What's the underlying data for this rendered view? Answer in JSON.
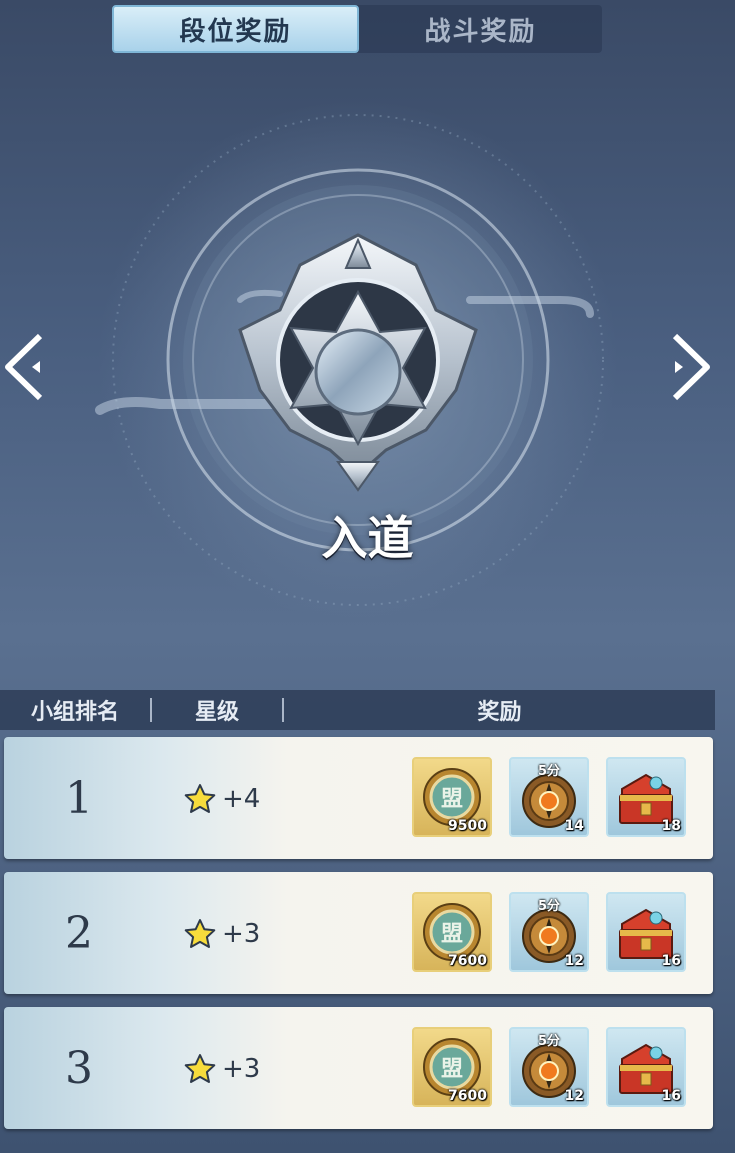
{
  "tabs": [
    {
      "label": "段位奖励",
      "active": true
    },
    {
      "label": "战斗奖励",
      "active": false
    }
  ],
  "rank": {
    "name": "入道"
  },
  "table": {
    "headers": {
      "rank": "小组排名",
      "stars": "星级",
      "reward": "奖励"
    },
    "rows": [
      {
        "rank": "1",
        "stars": "+4",
        "rewards": [
          {
            "icon": "alliance-coin-icon",
            "count": "9500"
          },
          {
            "icon": "bronze-compass-icon",
            "tag": "5分",
            "count": "14"
          },
          {
            "icon": "treasure-chest-icon",
            "count": "18"
          }
        ]
      },
      {
        "rank": "2",
        "stars": "+3",
        "rewards": [
          {
            "icon": "alliance-coin-icon",
            "count": "7600"
          },
          {
            "icon": "bronze-compass-icon",
            "tag": "5分",
            "count": "12"
          },
          {
            "icon": "treasure-chest-icon",
            "count": "16"
          }
        ]
      },
      {
        "rank": "3",
        "stars": "+3",
        "rewards": [
          {
            "icon": "alliance-coin-icon",
            "count": "7600"
          },
          {
            "icon": "bronze-compass-icon",
            "tag": "5分",
            "count": "12"
          },
          {
            "icon": "treasure-chest-icon",
            "count": "16"
          }
        ]
      }
    ]
  },
  "coin_glyph": "盟",
  "colors": {
    "accent": "#a9d2ea",
    "row_bg": "#f8f6ef",
    "text_dark": "#2e3a4a"
  }
}
